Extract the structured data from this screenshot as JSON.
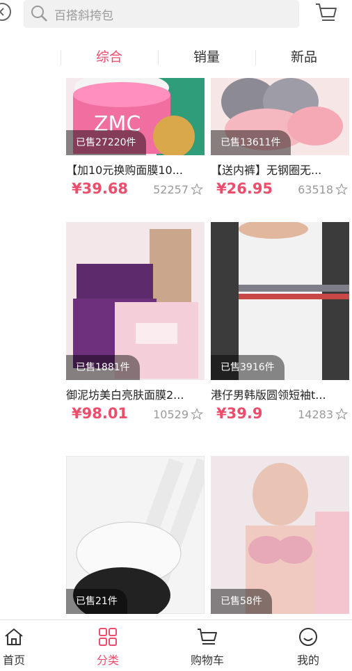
{
  "header": {
    "search_placeholder": "百搭斜挎包",
    "icons": [
      "back-icon",
      "search-icon",
      "cart-icon"
    ]
  },
  "tabs": [
    {
      "label": "综合",
      "active": true
    },
    {
      "label": "销量",
      "active": false
    },
    {
      "label": "新品",
      "active": false
    }
  ],
  "products": [
    {
      "title": "【加10元换购面膜10...",
      "price": "¥39.68",
      "sold": "已售27220件",
      "favs": "52257"
    },
    {
      "title": "【送内裤】无钢圈无...",
      "price": "¥26.95",
      "sold": "已售13611件",
      "favs": "63518"
    },
    {
      "title": "御泥坊美白亮肤面膜2...",
      "price": "¥98.01",
      "sold": "已售1881件",
      "favs": "10529"
    },
    {
      "title": "港仔男韩版圆领短袖t...",
      "price": "¥39.9",
      "sold": "已售3916件",
      "favs": "14283"
    },
    {
      "title": "",
      "price": "",
      "sold": "已售21件",
      "favs": ""
    },
    {
      "title": "",
      "price": "",
      "sold": "已售58件",
      "favs": ""
    }
  ],
  "bottom_nav": [
    {
      "label": "首页",
      "icon": "home-icon",
      "active": false
    },
    {
      "label": "分类",
      "icon": "grid-icon",
      "active": true
    },
    {
      "label": "购物车",
      "icon": "cart-icon",
      "active": false
    },
    {
      "label": "我的",
      "icon": "smile-icon",
      "active": false
    }
  ],
  "colors": {
    "accent": "#ee4c6b",
    "text": "#333333",
    "muted": "#999999"
  }
}
